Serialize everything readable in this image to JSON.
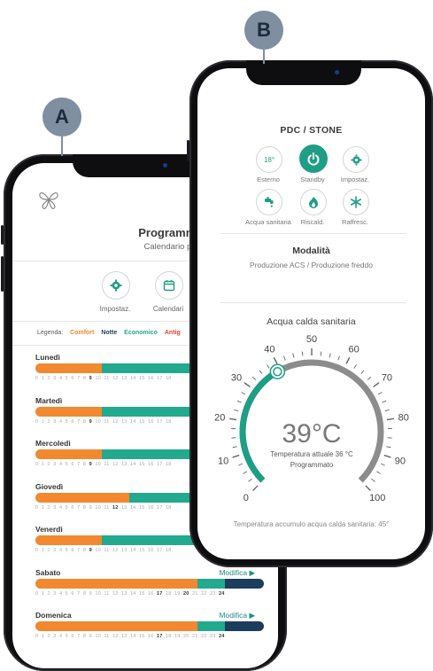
{
  "markers": {
    "a": "A",
    "b": "B"
  },
  "phone_a": {
    "logo_icon": "butterfly-logo-icon",
    "title": "Programmazione",
    "subtitle": "Calendario predefinito",
    "buttons": [
      {
        "label": "Impostaz.",
        "icon": "gear-icon"
      },
      {
        "label": "Calendari",
        "icon": "calendar-icon"
      }
    ],
    "legend": {
      "label": "Legenda:",
      "items": [
        {
          "label": "Comfort",
          "color": "#f2882f"
        },
        {
          "label": "Notte",
          "color": "#1d3d5c"
        },
        {
          "label": "Economico",
          "color": "#22a98e"
        },
        {
          "label": "Antig",
          "color": "#e2462f"
        }
      ]
    },
    "days": [
      {
        "name": "Lunedì",
        "edit": "",
        "ticks": [
          "0",
          "1",
          "2",
          "3",
          "4",
          "5",
          "6",
          "7",
          "8",
          "9",
          "10",
          "11",
          "12",
          "13",
          "14",
          "15",
          "16",
          "17",
          "18"
        ],
        "bold": [
          "9"
        ],
        "segments": [
          {
            "frac": 0.29,
            "color": "#f2882f"
          },
          {
            "frac": 0.71,
            "color": "#22a98e"
          }
        ]
      },
      {
        "name": "Martedì",
        "edit": "",
        "ticks": [
          "0",
          "1",
          "2",
          "3",
          "4",
          "5",
          "6",
          "7",
          "8",
          "9",
          "10",
          "11",
          "12",
          "13",
          "14",
          "15",
          "16",
          "17",
          "18"
        ],
        "bold": [
          "9"
        ],
        "segments": [
          {
            "frac": 0.29,
            "color": "#f2882f"
          },
          {
            "frac": 0.71,
            "color": "#22a98e"
          }
        ]
      },
      {
        "name": "Mercoledì",
        "edit": "",
        "ticks": [
          "0",
          "1",
          "2",
          "3",
          "4",
          "5",
          "6",
          "7",
          "8",
          "9",
          "10",
          "11",
          "12",
          "13",
          "14",
          "15",
          "16",
          "17",
          "18"
        ],
        "bold": [
          "9"
        ],
        "segments": [
          {
            "frac": 0.29,
            "color": "#f2882f"
          },
          {
            "frac": 0.71,
            "color": "#22a98e"
          }
        ]
      },
      {
        "name": "Giovedì",
        "edit": "",
        "ticks": [
          "0",
          "1",
          "2",
          "3",
          "4",
          "5",
          "6",
          "7",
          "8",
          "9",
          "10",
          "11",
          "12",
          "13",
          "14",
          "15",
          "16",
          "17",
          "18"
        ],
        "bold": [
          "12"
        ],
        "segments": [
          {
            "frac": 0.41,
            "color": "#f2882f"
          },
          {
            "frac": 0.59,
            "color": "#22a98e"
          }
        ]
      },
      {
        "name": "Venerdì",
        "edit": "",
        "ticks": [
          "0",
          "1",
          "2",
          "3",
          "4",
          "5",
          "6",
          "7",
          "8",
          "9",
          "10",
          "11",
          "12",
          "13",
          "14",
          "15",
          "16",
          "17",
          "18"
        ],
        "bold": [
          "9"
        ],
        "segments": [
          {
            "frac": 0.29,
            "color": "#f2882f"
          },
          {
            "frac": 0.71,
            "color": "#22a98e"
          }
        ]
      },
      {
        "name": "Sabato",
        "edit": "Modifica ▶",
        "ticks": [
          "0",
          "1",
          "2",
          "3",
          "4",
          "5",
          "6",
          "7",
          "8",
          "9",
          "10",
          "11",
          "12",
          "13",
          "14",
          "15",
          "16",
          "17",
          "18",
          "19",
          "20",
          "21",
          "22",
          "23",
          "24"
        ],
        "bold": [
          "17",
          "20",
          "24"
        ],
        "segments": [
          {
            "frac": 0.71,
            "color": "#f2882f"
          },
          {
            "frac": 0.12,
            "color": "#22a98e"
          },
          {
            "frac": 0.17,
            "color": "#1d3d5c"
          }
        ]
      },
      {
        "name": "Domenica",
        "edit": "Modifica ▶",
        "ticks": [
          "0",
          "1",
          "2",
          "3",
          "4",
          "5",
          "6",
          "7",
          "8",
          "9",
          "10",
          "11",
          "12",
          "13",
          "14",
          "15",
          "16",
          "17",
          "18",
          "19",
          "20",
          "21",
          "22",
          "23",
          "24"
        ],
        "bold": [
          "17",
          "24"
        ],
        "segments": [
          {
            "frac": 0.71,
            "color": "#f2882f"
          },
          {
            "frac": 0.12,
            "color": "#22a98e"
          },
          {
            "frac": 0.17,
            "color": "#1d3d5c"
          }
        ]
      }
    ]
  },
  "phone_b": {
    "title": "PDC / STONE",
    "icons_row1": [
      {
        "label": "Esterno",
        "value": "18°",
        "icon": "thermometer-icon"
      },
      {
        "label": "Standby",
        "value": "",
        "icon": "power-icon",
        "active": true
      },
      {
        "label": "Impostaz.",
        "value": "",
        "icon": "gear-icon"
      }
    ],
    "icons_row2": [
      {
        "label": "Acqua sanitaria",
        "icon": "faucet-icon"
      },
      {
        "label": "Riscald.",
        "icon": "flame-icon"
      },
      {
        "label": "Raffresc.",
        "icon": "snowflake-icon"
      }
    ],
    "mode_title": "Modalità",
    "mode_value": "Produzione ACS / Produzione freddo",
    "gauge_title": "Acqua calda sanitaria",
    "gauge": {
      "min": 0,
      "max": 100,
      "setpoint": 39,
      "current": 36,
      "scale_labels": [
        "0",
        "10",
        "20",
        "30",
        "40",
        "50",
        "60",
        "70",
        "80",
        "90",
        "100"
      ],
      "setpoint_text": "39°C",
      "current_text": "Temperatura attuale 36 °C",
      "mode_text": "Programmato",
      "active_color": "#1e9e85",
      "track_color": "#8c8c8c"
    },
    "footer": "Temperatura accumulo acqua calda sanitaria: 45°"
  }
}
